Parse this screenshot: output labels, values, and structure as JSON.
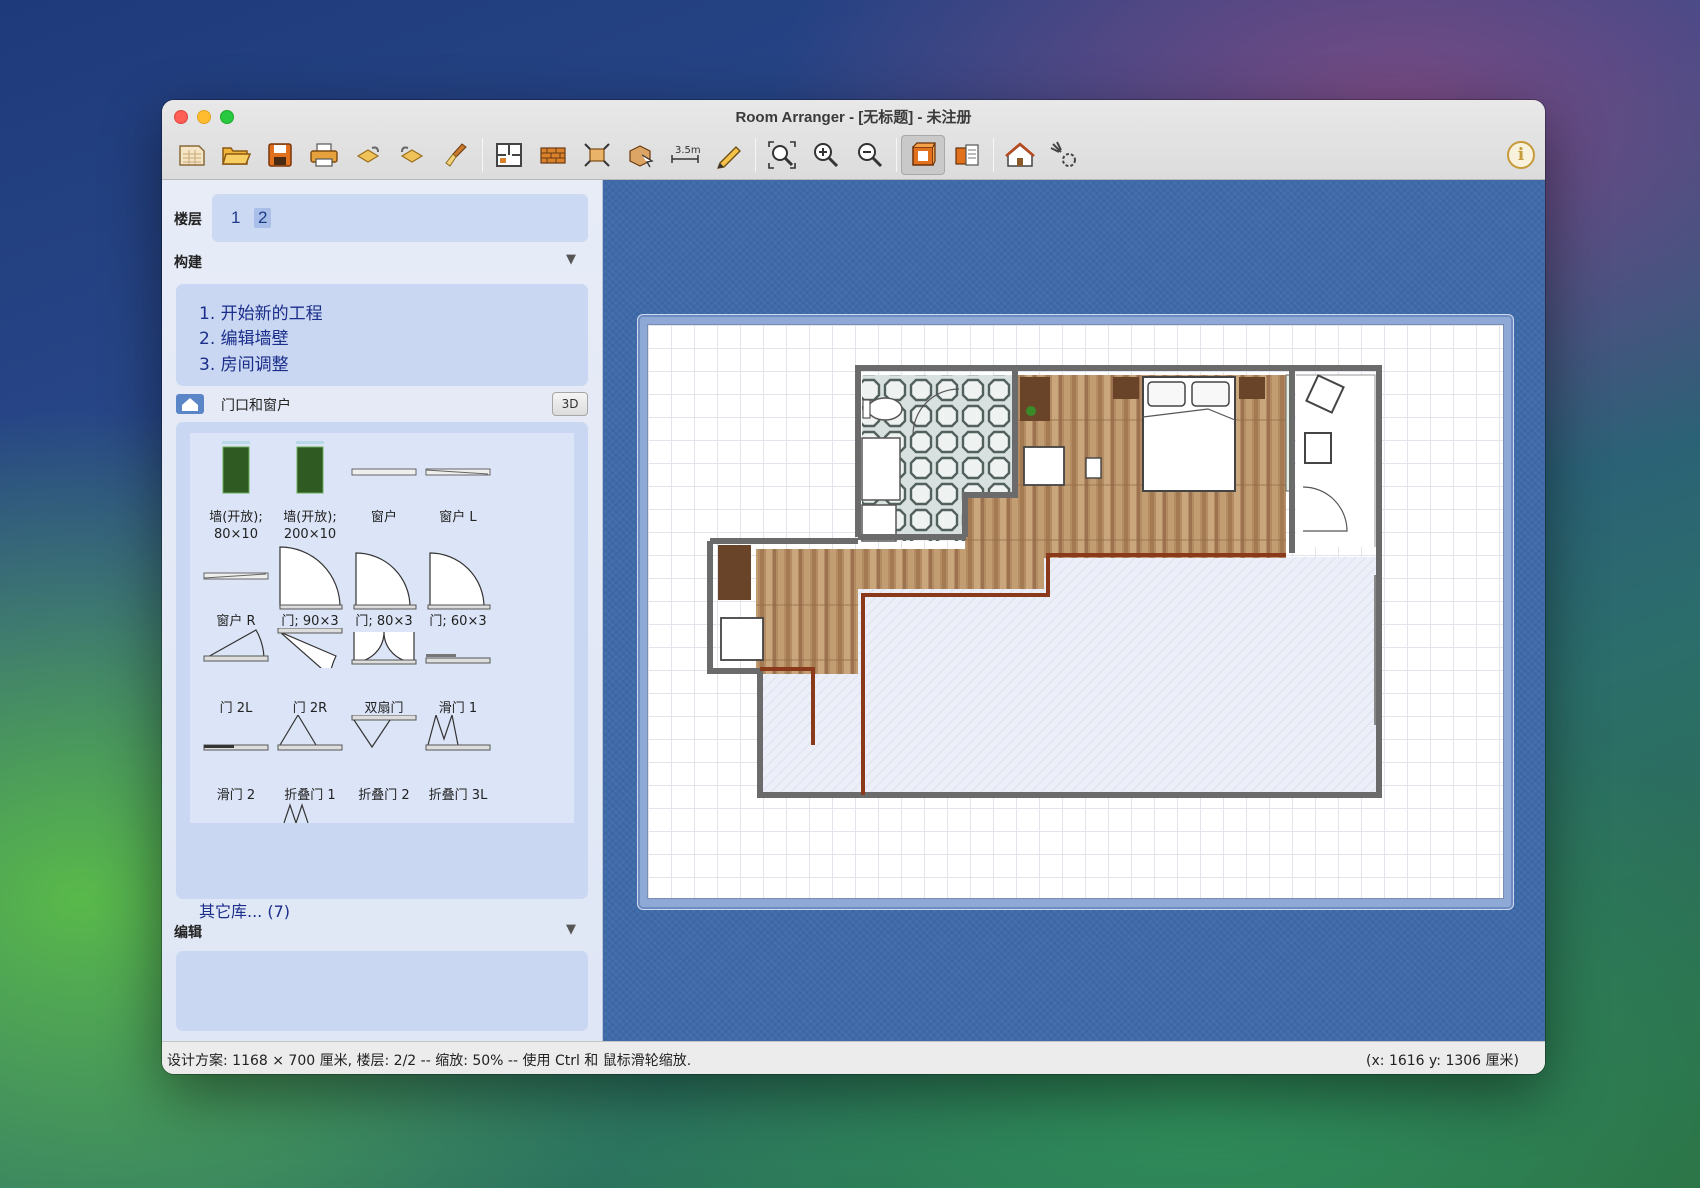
{
  "window": {
    "title": "Room Arranger - [无标题] - 未注册"
  },
  "toolbar": {
    "buttons": [
      {
        "name": "new-project-icon"
      },
      {
        "name": "open-folder-icon"
      },
      {
        "name": "save-icon"
      },
      {
        "name": "print-icon"
      },
      {
        "name": "undo-icon"
      },
      {
        "name": "redo-icon"
      },
      {
        "name": "clear-brush-icon"
      },
      {
        "name": "floorplan-icon"
      },
      {
        "name": "wall-icon"
      },
      {
        "name": "resize-icon"
      },
      {
        "name": "move-object-icon"
      },
      {
        "name": "measure-icon",
        "label": "3.5m"
      },
      {
        "name": "pencil-icon"
      },
      {
        "name": "zoom-fit-icon"
      },
      {
        "name": "zoom-in-icon"
      },
      {
        "name": "zoom-out-icon"
      },
      {
        "name": "box-view-icon"
      },
      {
        "name": "objects-list-icon"
      },
      {
        "name": "house-3d-icon"
      },
      {
        "name": "settings-3d-icon"
      }
    ],
    "info_label": "i"
  },
  "left_panel": {
    "floors_label": "楼层",
    "floors": [
      "1",
      "2"
    ],
    "selected_floor": "2",
    "build_label": "构建",
    "build_links": [
      "1. 开始新的工程",
      "2. 编辑墙壁",
      "3. 房间调整"
    ],
    "doors_section_label": "门口和窗户",
    "btn_3d": "3D",
    "catalog": [
      {
        "label": "墙(开放);\n80×10"
      },
      {
        "label": "墙(开放);\n200×10"
      },
      {
        "label": "窗户"
      },
      {
        "label": "窗户 L"
      },
      {
        "label": "窗户 R"
      },
      {
        "label": "门; 90×3"
      },
      {
        "label": "门; 80×3"
      },
      {
        "label": "门; 60×3"
      },
      {
        "label": "门 2L"
      },
      {
        "label": "门 2R"
      },
      {
        "label": "双扇门"
      },
      {
        "label": "滑门 1"
      },
      {
        "label": "滑门 2"
      },
      {
        "label": "折叠门 1"
      },
      {
        "label": "折叠门 2"
      },
      {
        "label": "折叠门 3L"
      }
    ],
    "more_libraries": "其它库... (7)",
    "edit_label": "编辑"
  },
  "statusbar": {
    "left": "设计方案: 1168 × 700 厘米, 楼层: 2/2 -- 缩放: 50% -- 使用 Ctrl 和 鼠标滑轮缩放.",
    "right": "(x: 1616 y: 1306 厘米)"
  },
  "colors": {
    "canvas_bg": "#3f6bab",
    "panel_bg": "#dfe6f5",
    "link": "#1b2e8a",
    "wood_floor": "#b8936a",
    "wall": "#666666",
    "partition": "#8a3a1a"
  }
}
